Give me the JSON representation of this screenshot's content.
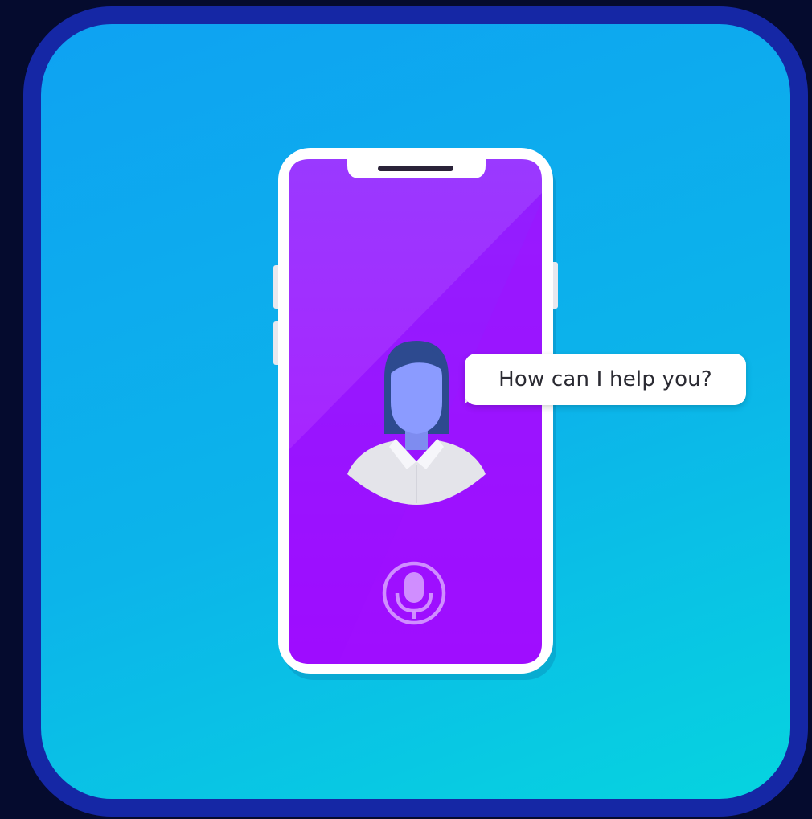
{
  "speech_bubble": {
    "text": "How can I help you?"
  },
  "icons": {
    "phone": "smartphone-icon",
    "assistant": "assistant-avatar-icon",
    "microphone": "microphone-icon"
  },
  "colors": {
    "outer_background": "#050b2e",
    "icon_border": "#1527a5",
    "icon_gradient_start": "#0ea2f2",
    "icon_gradient_end": "#06d4df",
    "phone_screen_top": "#9a39ff",
    "phone_screen_bottom": "#b016ff",
    "phone_frame": "#ffffff",
    "avatar_face": "#8b9bff",
    "avatar_hair": "#2d4a8f",
    "avatar_shirt": "#e4e4ea"
  }
}
